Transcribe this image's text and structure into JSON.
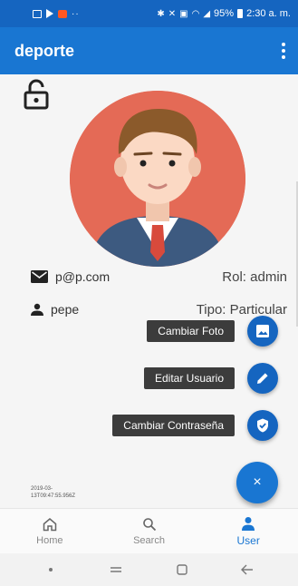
{
  "status_bar": {
    "dots": "··",
    "time": "2:30 a. m.",
    "battery": "95%",
    "icons": [
      "gallery-icon",
      "play-icon",
      "app-icon",
      "bluetooth-icon",
      "mute-icon",
      "nfc-icon",
      "wifi-icon",
      "signal-icon",
      "battery-icon"
    ]
  },
  "app_bar": {
    "title": "deporte",
    "menu_icon": "more-vert-icon"
  },
  "profile": {
    "lock_icon": "lock-open-icon",
    "avatar_icon": "user-avatar",
    "email": "p@p.com",
    "role": "Rol: admin",
    "username": "pepe",
    "type": "Tipo: Particular",
    "timestamp": "2019-03-13T09:47:55.956Z"
  },
  "actions": [
    {
      "label": "Cambiar Foto",
      "icon": "image-icon"
    },
    {
      "label": "Editar Usuario",
      "icon": "edit-icon"
    },
    {
      "label": "Cambiar Contraseña",
      "icon": "shield-check-icon"
    }
  ],
  "fab": {
    "label": "×",
    "icon": "close-icon"
  },
  "bottom_nav": [
    {
      "label": "Home",
      "icon": "home-icon",
      "active": false
    },
    {
      "label": "Search",
      "icon": "search-icon",
      "active": false
    },
    {
      "label": "User",
      "icon": "person-icon",
      "active": true
    }
  ],
  "colors": {
    "primary": "#1976d2",
    "primary_dark": "#1565c0",
    "avatar_bg": "#e46a56",
    "tooltip_bg": "#3c3c3c"
  }
}
